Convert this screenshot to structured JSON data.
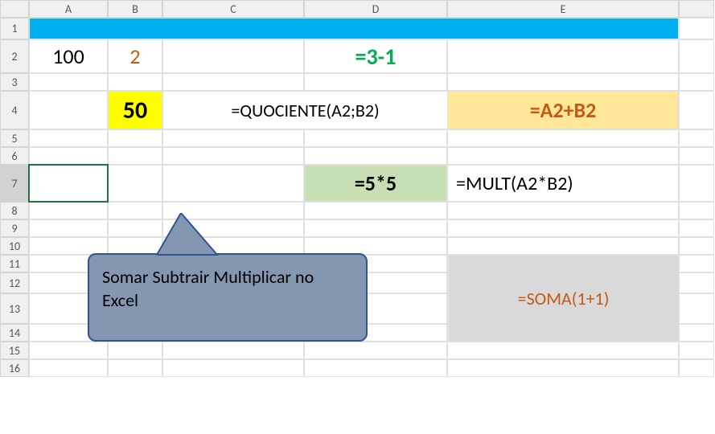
{
  "columns": [
    "A",
    "B",
    "C",
    "D",
    "E"
  ],
  "rows": [
    "1",
    "2",
    "3",
    "4",
    "5",
    "6",
    "7",
    "8",
    "9",
    "10",
    "11",
    "12",
    "13",
    "14",
    "15",
    "16"
  ],
  "cells": {
    "A2": "100",
    "B2": "2",
    "D2": "=3-1",
    "B4": "50",
    "C4": "=QUOCIENTE(A2;B2)",
    "E4": "=A2+B2",
    "D7": "=5*5",
    "E7": "=MULT(A2*B2)",
    "E12": "=SOMA(1+1)"
  },
  "callout_text": "Somar Subtrair Multiplicar no Excel"
}
